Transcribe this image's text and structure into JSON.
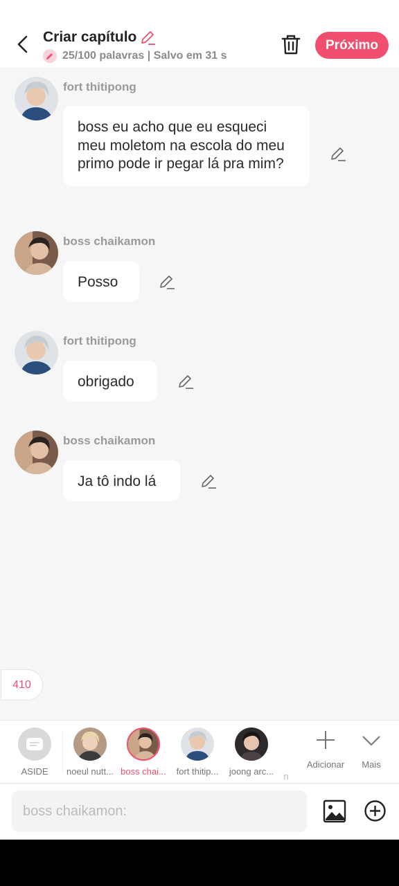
{
  "header": {
    "title": "Criar capítulo",
    "meta": "25/100 palavras | Salvo em 31 s",
    "next_label": "Próximo"
  },
  "messages": [
    {
      "sender": "fort thitipong",
      "text": "boss eu acho que eu esqueci meu moletom na escola do meu primo pode ir pegar lá pra mim?"
    },
    {
      "sender": "boss chaikamon",
      "text": "Posso"
    },
    {
      "sender": "fort thitipong",
      "text": "obrigado"
    },
    {
      "sender": "boss chaikamon",
      "text": "Ja tô indo lá"
    }
  ],
  "word_counter": "410",
  "characters": [
    {
      "label": "ASIDE"
    },
    {
      "label": "noeul nutt..."
    },
    {
      "label": "boss chai..."
    },
    {
      "label": "fort thitip..."
    },
    {
      "label": "joong arc..."
    },
    {
      "label": "n"
    }
  ],
  "tools": {
    "add_label": "Adicionar",
    "more_label": "Mais"
  },
  "input": {
    "placeholder": "boss chaikamon:"
  },
  "colors": {
    "accent": "#f14f6f",
    "background": "#f6f6f6"
  }
}
